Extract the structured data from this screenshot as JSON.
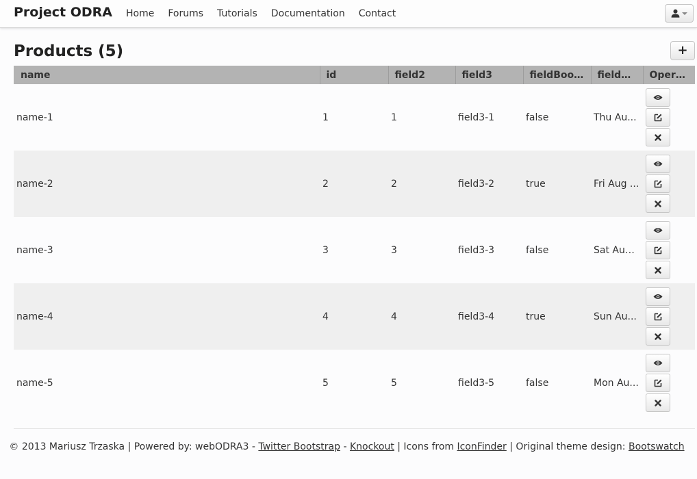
{
  "navbar": {
    "brand": "Project ODRA",
    "links": [
      "Home",
      "Forums",
      "Tutorials",
      "Documentation",
      "Contact"
    ],
    "user_icon": "user-icon"
  },
  "page": {
    "title": "Products (5)",
    "add_label": "+"
  },
  "table": {
    "columns": [
      "name",
      "id",
      "field2",
      "field3",
      "fieldBoolean",
      "fieldDate",
      "Operat..."
    ],
    "rows": [
      {
        "name": "name-1",
        "id": "1",
        "field2": "1",
        "field3": "field3-1",
        "fieldBoolean": "false",
        "fieldDate": "Thu Au..."
      },
      {
        "name": "name-2",
        "id": "2",
        "field2": "2",
        "field3": "field3-2",
        "fieldBoolean": "true",
        "fieldDate": "Fri Aug ..."
      },
      {
        "name": "name-3",
        "id": "3",
        "field2": "3",
        "field3": "field3-3",
        "fieldBoolean": "false",
        "fieldDate": "Sat Aug..."
      },
      {
        "name": "name-4",
        "id": "4",
        "field2": "4",
        "field3": "field3-4",
        "fieldBoolean": "true",
        "fieldDate": "Sun Au..."
      },
      {
        "name": "name-5",
        "id": "5",
        "field2": "5",
        "field3": "field3-5",
        "fieldBoolean": "false",
        "fieldDate": "Mon Au..."
      }
    ],
    "operation_icons": {
      "view": "eye-icon",
      "edit": "edit-icon",
      "delete": "close-icon"
    }
  },
  "footer": {
    "copyright": "© 2013 Mariusz Trzaska | Powered by: webODRA3 -",
    "link_bootstrap": "Twitter Bootstrap",
    "sep_dash": "-",
    "link_knockout": "Knockout",
    "icons_text": "| Icons from",
    "link_iconfinder": "IconFinder",
    "theme_text": "| Original theme design:",
    "link_bootswatch": "Bootswatch"
  }
}
